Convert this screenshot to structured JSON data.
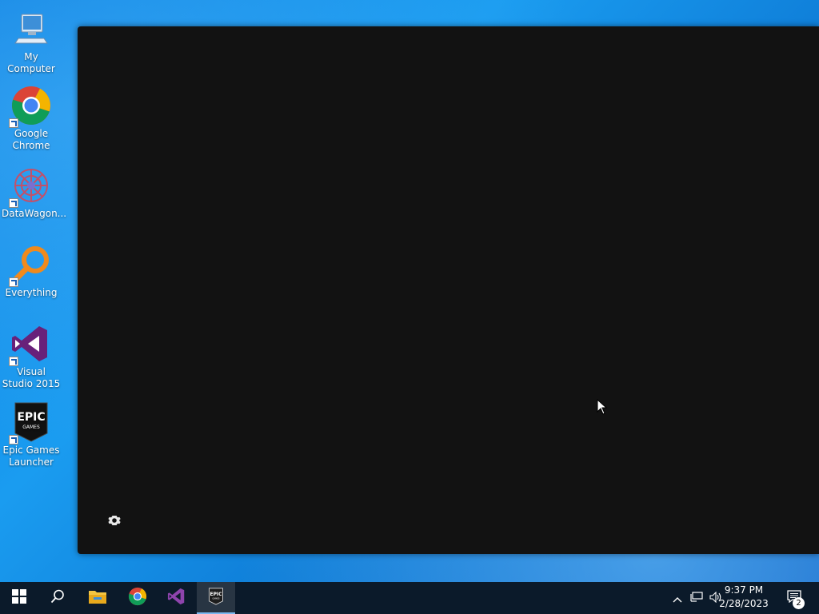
{
  "desktop": {
    "icons": [
      {
        "label": "My Computer",
        "icon": "computer-icon"
      },
      {
        "label": "Google Chrome",
        "icon": "chrome-icon"
      },
      {
        "label": "DataWagon...",
        "icon": "datawagon-icon"
      },
      {
        "label": "Everything",
        "icon": "everything-search-icon"
      },
      {
        "label": "Visual Studio 2015",
        "icon": "visual-studio-icon"
      },
      {
        "label": "Epic Games Launcher",
        "icon": "epic-games-icon"
      }
    ]
  },
  "app_window": {
    "background": "#121212",
    "settings_icon": "gear-icon"
  },
  "taskbar": {
    "buttons": [
      {
        "icon": "windows-start-icon"
      },
      {
        "icon": "search-icon"
      },
      {
        "icon": "file-explorer-icon"
      },
      {
        "icon": "chrome-icon"
      },
      {
        "icon": "visual-studio-icon"
      },
      {
        "icon": "epic-games-icon",
        "active": true
      }
    ],
    "tray": {
      "time": "9:37 PM",
      "date": "2/28/2023",
      "notification_count": "2"
    }
  },
  "colors": {
    "wallpaper": "#1a9cf0",
    "taskbar": "#0b1a2a",
    "active_indicator": "#7ab8f0"
  }
}
